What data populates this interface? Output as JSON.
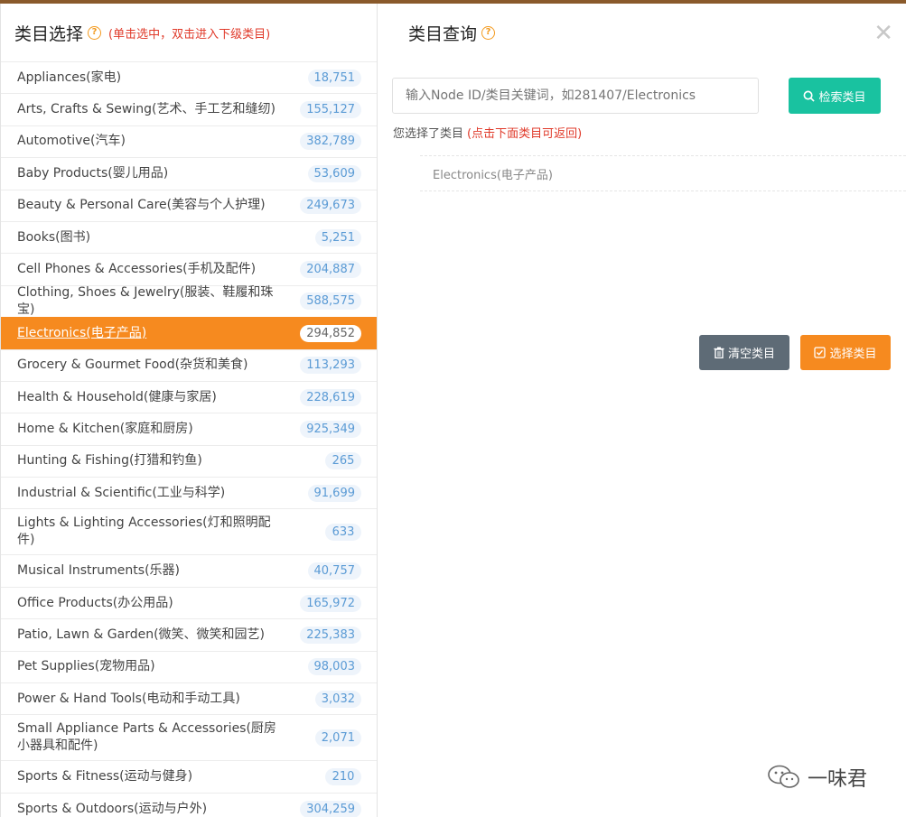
{
  "left": {
    "title": "类目选择",
    "hint": "(单击选中，双击进入下级类目)",
    "categories": [
      {
        "name": "Appliances(家电)",
        "count": "18,751"
      },
      {
        "name": "Arts, Crafts & Sewing(艺术、手工艺和缝纫)",
        "count": "155,127"
      },
      {
        "name": "Automotive(汽车)",
        "count": "382,789"
      },
      {
        "name": "Baby Products(婴儿用品)",
        "count": "53,609"
      },
      {
        "name": "Beauty & Personal Care(美容与个人护理)",
        "count": "249,673"
      },
      {
        "name": "Books(图书)",
        "count": "5,251"
      },
      {
        "name": "Cell Phones & Accessories(手机及配件)",
        "count": "204,887"
      },
      {
        "name": "Clothing, Shoes & Jewelry(服装、鞋履和珠宝)",
        "count": "588,575"
      },
      {
        "name": "Electronics(电子产品)",
        "count": "294,852"
      },
      {
        "name": "Grocery & Gourmet Food(杂货和美食)",
        "count": "113,293"
      },
      {
        "name": "Health & Household(健康与家居)",
        "count": "228,619"
      },
      {
        "name": "Home & Kitchen(家庭和厨房)",
        "count": "925,349"
      },
      {
        "name": "Hunting & Fishing(打猎和钓鱼)",
        "count": "265"
      },
      {
        "name": "Industrial & Scientific(工业与科学)",
        "count": "91,699"
      },
      {
        "name": "Lights & Lighting Accessories(灯和照明配件)",
        "count": "633"
      },
      {
        "name": "Musical Instruments(乐器)",
        "count": "40,757"
      },
      {
        "name": "Office Products(办公用品)",
        "count": "165,972"
      },
      {
        "name": "Patio, Lawn & Garden(微笑、微笑和园艺)",
        "count": "225,383"
      },
      {
        "name": "Pet Supplies(宠物用品)",
        "count": "98,003"
      },
      {
        "name": "Power & Hand Tools(电动和手动工具)",
        "count": "3,032"
      },
      {
        "name": "Small Appliance Parts & Accessories(厨房小器具和配件)",
        "count": "2,071"
      },
      {
        "name": "Sports & Fitness(运动与健身)",
        "count": "210"
      },
      {
        "name": "Sports & Outdoors(运动与户外)",
        "count": "304,259"
      }
    ]
  },
  "right": {
    "title": "类目查询",
    "search_placeholder": "输入Node ID/类目关键词，如281407/Electronics",
    "search_button": "检索类目",
    "selected_label": "您选择了类目",
    "selected_hint": "(点击下面类目可返回)",
    "selected_value": "Electronics(电子产品)",
    "clear_button": "清空类目",
    "select_button": "选择类目",
    "help_glyph": "?",
    "close_glyph": "✕"
  },
  "watermark": {
    "text": "一味君"
  },
  "colors": {
    "accent": "#f68a1f",
    "teal": "#19c2a0",
    "slate": "#5e6b76",
    "hint_red": "#e03a2a"
  }
}
